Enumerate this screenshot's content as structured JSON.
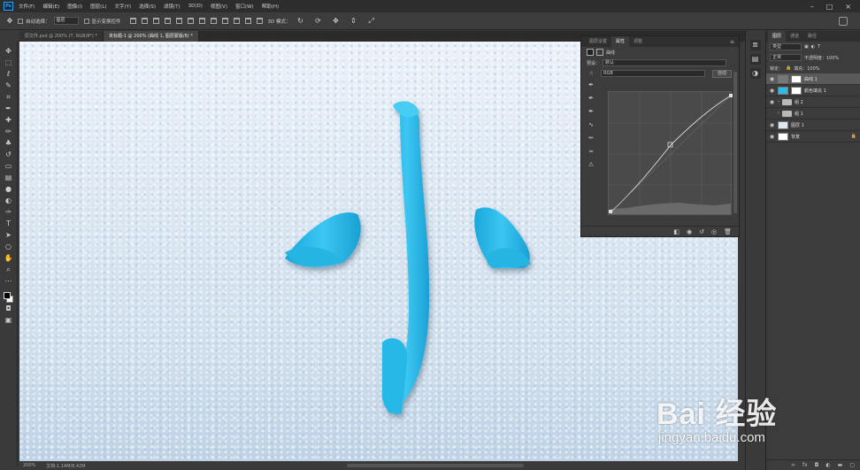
{
  "app": {
    "logo": "Ps"
  },
  "menu": [
    "文件(F)",
    "编辑(E)",
    "图像(I)",
    "图层(L)",
    "文字(Y)",
    "选择(S)",
    "滤镜(T)",
    "3D(D)",
    "视图(V)",
    "窗口(W)",
    "帮助(H)"
  ],
  "options": {
    "auto_select_label": "自动选择：",
    "auto_select_value": "图层",
    "show_transform_label": "显示变换控件",
    "mode3d_label": "3D 模式："
  },
  "tabs": [
    {
      "label": "原文件.psd @ 200% (T, RGB/8*) *",
      "active": false
    },
    {
      "label": "未标题-1 @ 200% (曲线 1, 图层蒙版/8) *",
      "active": true
    }
  ],
  "status": {
    "zoom": "200%",
    "doc": "文档:1.14M/8.42M"
  },
  "properties": {
    "tabs": [
      {
        "label": "图层设置",
        "active": false
      },
      {
        "label": "属性",
        "active": true
      },
      {
        "label": "调整",
        "active": false
      }
    ],
    "title": "曲线",
    "preset_label": "预设：",
    "preset_value": "默认",
    "channel_value": "RGB",
    "auto_label": "自动"
  },
  "layers": {
    "tabs": [
      {
        "label": "图层",
        "active": true
      },
      {
        "label": "通道",
        "active": false
      },
      {
        "label": "路径",
        "active": false
      }
    ],
    "kind_label": "类型",
    "blend_mode": "正常",
    "opacity_label": "不透明度：100%",
    "lock_label": "锁定：",
    "fill_label": "填充：100%",
    "items": [
      {
        "name": "曲线 1",
        "type": "adjustment",
        "selected": true
      },
      {
        "name": "颜色填充 1",
        "type": "fill",
        "selected": false
      },
      {
        "name": "组 2",
        "type": "group",
        "selected": false
      },
      {
        "name": "组 1",
        "type": "group",
        "selected": false
      },
      {
        "name": "图层 1",
        "type": "layer",
        "selected": false
      },
      {
        "name": "背景",
        "type": "background",
        "selected": false
      }
    ]
  },
  "watermark": {
    "title": "Bai 经验",
    "url": "jingyan.baidu.com"
  },
  "colors": {
    "stroke": "#2bbbe8",
    "stroke_dark": "#1a9ac8",
    "ps_accent": "#2fa3f0"
  }
}
